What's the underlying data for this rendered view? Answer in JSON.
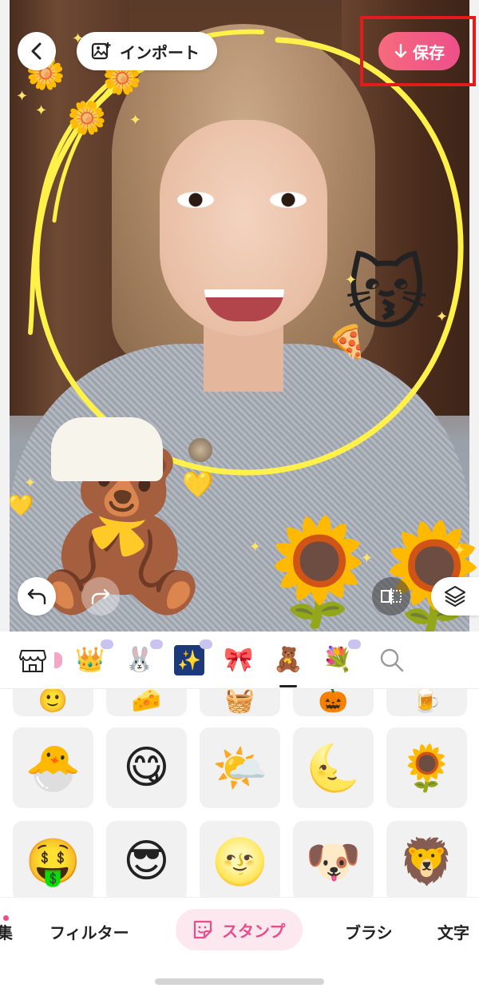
{
  "header": {
    "import_label": "インポート",
    "save_label": "保存"
  },
  "canvas_stickers": {
    "flowers": [
      "🌼",
      "🌼",
      "🌼"
    ],
    "cat": "😽",
    "pizza": "🍕",
    "bear": "🧸",
    "chef_hat": "👨‍🍳",
    "sunflower": "🌻",
    "heart": "💛"
  },
  "sticker_categories": [
    {
      "icon": "store-icon",
      "glyph": "🏪",
      "premium": false
    },
    {
      "icon": "crown-icon",
      "glyph": "👑",
      "premium": true
    },
    {
      "icon": "bunny-ears-icon",
      "glyph": "🐰",
      "premium": true
    },
    {
      "icon": "sparkle-frame-icon",
      "glyph": "✨",
      "premium": true
    },
    {
      "icon": "bow-icon",
      "glyph": "🎀",
      "premium": false
    },
    {
      "icon": "chef-bear-icon",
      "glyph": "🧸",
      "premium": false,
      "active": true
    },
    {
      "icon": "flower-person-icon",
      "glyph": "💐",
      "premium": true
    },
    {
      "icon": "search-icon",
      "glyph": "",
      "premium": false
    }
  ],
  "sticker_grid": {
    "row_partial": [
      "🙂",
      "🧀",
      "🧺",
      "🎃",
      "🍺"
    ],
    "row_1": [
      "🐣",
      "😋",
      "🌤️",
      "🌜",
      "🌻"
    ],
    "row_2": [
      "🤑",
      "😎",
      "🌝",
      "🐶",
      "🦁"
    ]
  },
  "tool_tabs": {
    "edit_fragment": "集",
    "filter": "フィルター",
    "stamp": "スタンプ",
    "brush": "ブラシ",
    "text": "文字"
  },
  "colors": {
    "accent_pink": "#ec4c8a",
    "save_gradient_start": "#f66a7d",
    "save_gradient_end": "#ee4f8a",
    "highlight_red": "#e31b1b",
    "doodle_yellow": "#fff04a"
  }
}
